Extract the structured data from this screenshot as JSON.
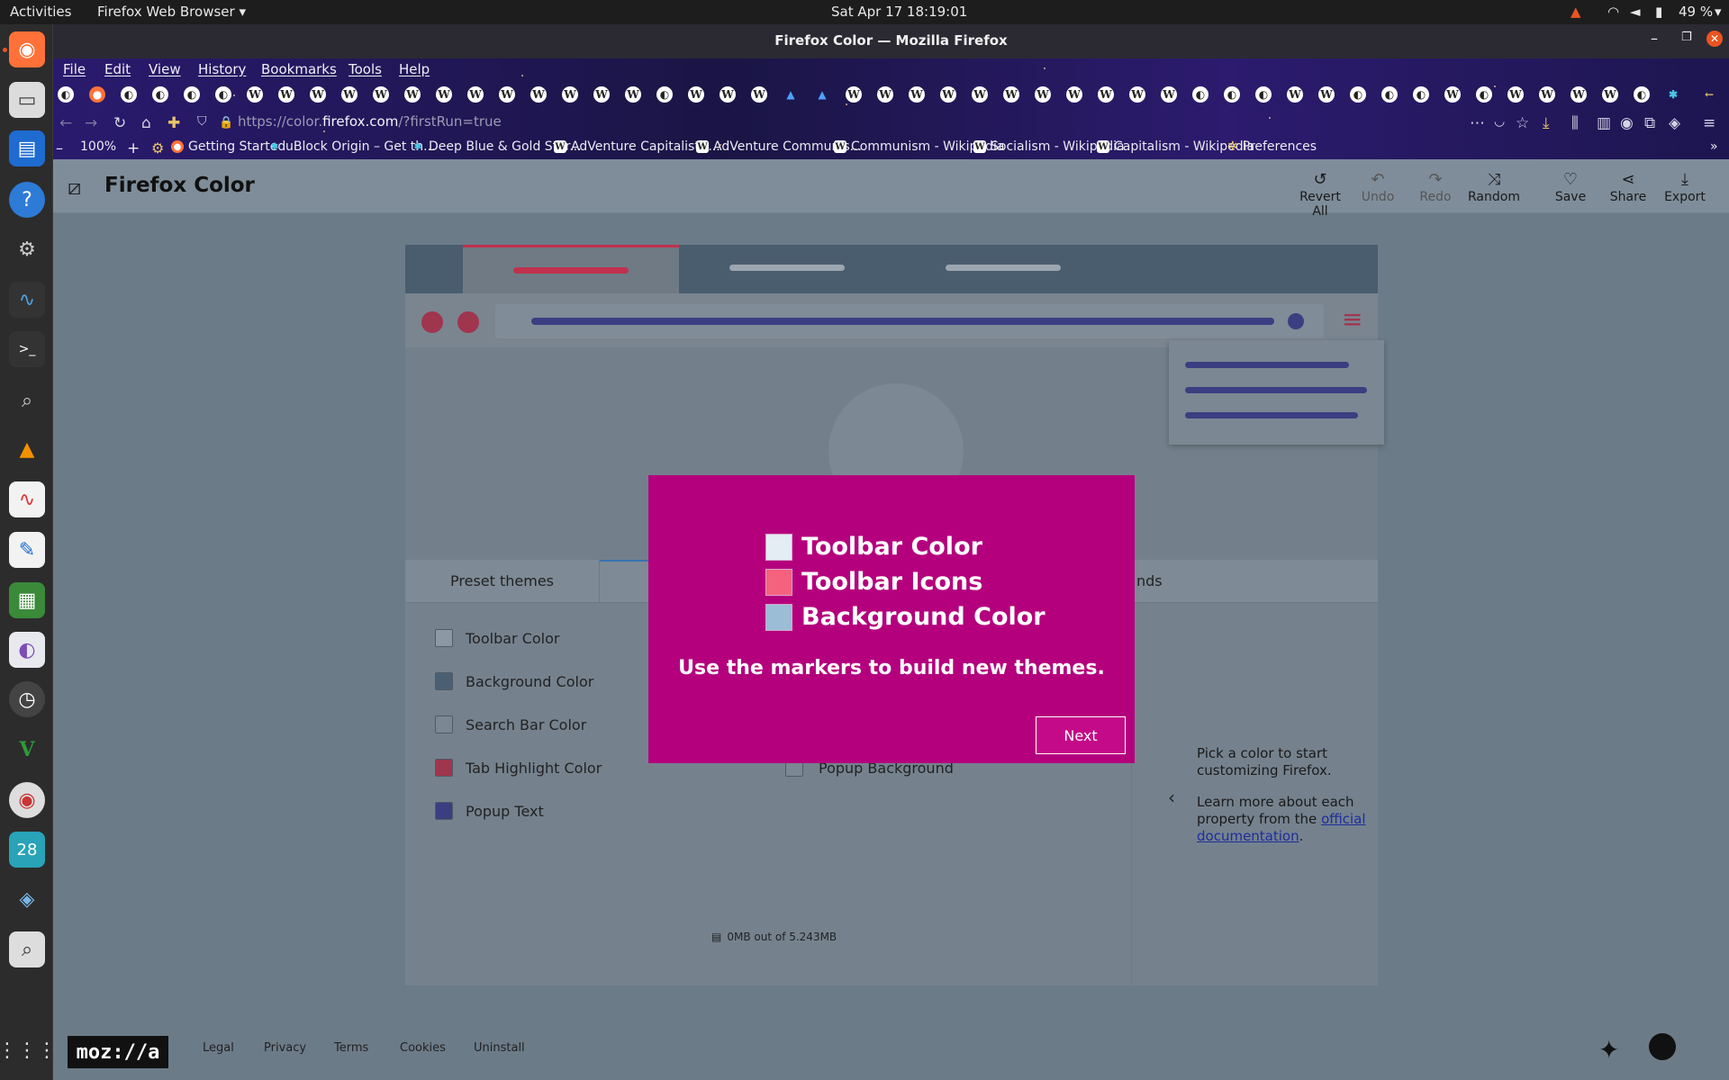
{
  "system_bar": {
    "activities": "Activities",
    "app": "Firefox Web Browser",
    "clock": "Sat Apr 17  18:19:01",
    "battery": "49 %"
  },
  "window": {
    "title": "Firefox Color — Mozilla Firefox"
  },
  "menu": [
    "File",
    "Edit",
    "View",
    "History",
    "Bookmarks",
    "Tools",
    "Help"
  ],
  "navbar": {
    "url_prefix": "https://color.",
    "url_domain": "firefox.com",
    "url_path": "/?firstRun=true",
    "zoom": "100%"
  },
  "bookmarks": [
    "Getting Started",
    "uBlock Origin – Get th...",
    "Deep Blue & Gold Star...",
    "AdVenture Capitalist -...",
    "AdVenture Communis...",
    "Communism - Wikipedia",
    "Socialism - Wikipedia",
    "Capitalism - Wikipedia",
    "Preferences"
  ],
  "app": {
    "title": "Firefox Color",
    "toolbar": {
      "revert": "Revert All",
      "undo": "Undo",
      "redo": "Redo",
      "random": "Random",
      "save": "Save",
      "share": "Share",
      "export": "Export"
    }
  },
  "panel": {
    "tab_preset": "Preset themes",
    "tab_partial": "nds",
    "properties": [
      {
        "label": "Toolbar Color",
        "color": "#8c98a4"
      },
      {
        "label": "Background Color",
        "color": "#4a6072"
      },
      {
        "label": "Search Bar Color",
        "color": "#7b8793"
      },
      {
        "label": "Tab Highlight Color",
        "color": "#a0354e"
      },
      {
        "label": "Popup Text",
        "color": "#3b3f82"
      }
    ],
    "popup_background": "Popup Background",
    "storage": "0MB out of 5.243MB",
    "help_line1": "Pick a color to start customizing Firefox.",
    "help_line2": "Learn more about each property from the",
    "help_link": "official documentation",
    "help_end": "."
  },
  "modal": {
    "items": [
      {
        "label": "Toolbar Color",
        "color": "#e4ecf4"
      },
      {
        "label": "Toolbar Icons",
        "color": "#f5627e"
      },
      {
        "label": "Background Color",
        "color": "#9bbdd6"
      }
    ],
    "message": "Use the markers to build new themes.",
    "next": "Next"
  },
  "footer": {
    "logo": "moz://a",
    "links": [
      "Legal",
      "Privacy",
      "Terms",
      "Cookies",
      "Uninstall"
    ]
  }
}
